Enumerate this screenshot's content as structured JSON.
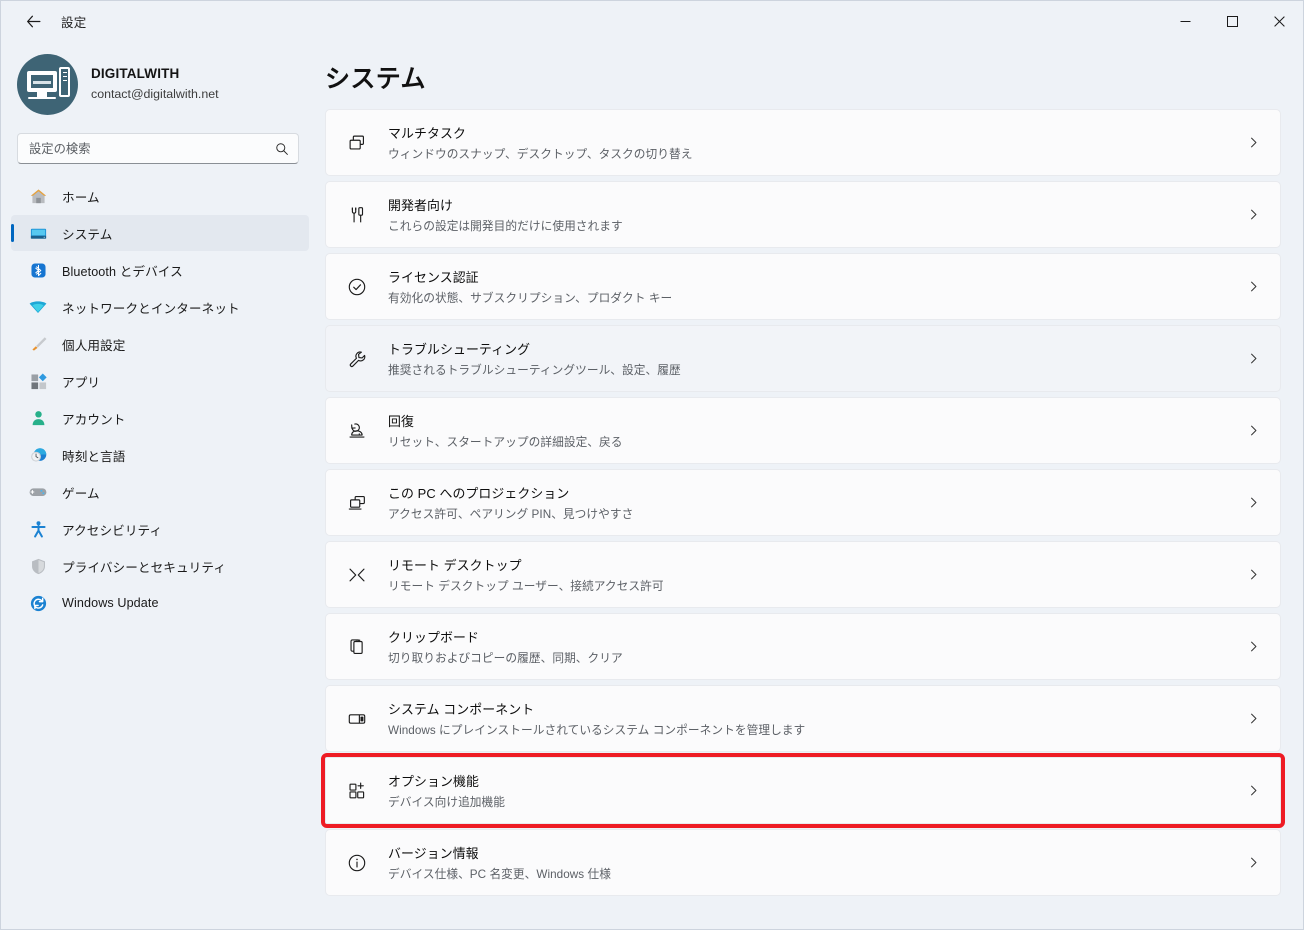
{
  "titlebar": {
    "back_icon": "arrow-left-icon",
    "title": "設定",
    "minimize_label": "–",
    "maximize_label": "□",
    "close_label": "✕"
  },
  "account": {
    "name": "DIGITALWITH",
    "email": "contact@digitalwith.net",
    "avatar_color": "#3e6475"
  },
  "search": {
    "placeholder": "設定の検索",
    "value": "",
    "icon": "search-icon"
  },
  "sidebar": {
    "accent_color": "#0067c0",
    "background": "#eef2f7",
    "items": [
      {
        "label": "ホーム",
        "icon": "home-icon",
        "active": false
      },
      {
        "label": "システム",
        "icon": "monitor-icon",
        "active": true
      },
      {
        "label": "Bluetooth とデバイス",
        "icon": "bluetooth-icon",
        "active": false
      },
      {
        "label": "ネットワークとインターネット",
        "icon": "wifi-icon",
        "active": false
      },
      {
        "label": "個人用設定",
        "icon": "paintbrush-icon",
        "active": false
      },
      {
        "label": "アプリ",
        "icon": "apps-icon",
        "active": false
      },
      {
        "label": "アカウント",
        "icon": "person-icon",
        "active": false
      },
      {
        "label": "時刻と言語",
        "icon": "clock-globe-icon",
        "active": false
      },
      {
        "label": "ゲーム",
        "icon": "gamepad-icon",
        "active": false
      },
      {
        "label": "アクセシビリティ",
        "icon": "accessibility-icon",
        "active": false
      },
      {
        "label": "プライバシーとセキュリティ",
        "icon": "shield-icon",
        "active": false
      },
      {
        "label": "Windows Update",
        "icon": "update-icon",
        "active": false
      }
    ]
  },
  "main": {
    "page_title": "システム",
    "highlight_color": "#ee1b24",
    "cards": [
      {
        "title": "マルチタスク",
        "subtitle": "ウィンドウのスナップ、デスクトップ、タスクの切り替え",
        "icon": "multitask-icon",
        "hovered": false,
        "highlight": false
      },
      {
        "title": "開発者向け",
        "subtitle": "これらの設定は開発目的だけに使用されます",
        "icon": "tools-icon",
        "hovered": false,
        "highlight": false
      },
      {
        "title": "ライセンス認証",
        "subtitle": "有効化の状態、サブスクリプション、プロダクト キー",
        "icon": "check-circle-icon",
        "hovered": false,
        "highlight": false
      },
      {
        "title": "トラブルシューティング",
        "subtitle": "推奨されるトラブルシューティングツール、設定、履歴",
        "icon": "wrench-icon",
        "hovered": true,
        "highlight": false
      },
      {
        "title": "回復",
        "subtitle": "リセット、スタートアップの詳細設定、戻る",
        "icon": "recovery-icon",
        "hovered": false,
        "highlight": false
      },
      {
        "title": "この PC へのプロジェクション",
        "subtitle": "アクセス許可、ペアリング PIN、見つけやすさ",
        "icon": "projection-icon",
        "hovered": false,
        "highlight": false
      },
      {
        "title": "リモート デスクトップ",
        "subtitle": "リモート デスクトップ ユーザー、接続アクセス許可",
        "icon": "remote-desktop-icon",
        "hovered": false,
        "highlight": false
      },
      {
        "title": "クリップボード",
        "subtitle": "切り取りおよびコピーの履歴、同期、クリア",
        "icon": "clipboard-icon",
        "hovered": false,
        "highlight": false
      },
      {
        "title": "システム コンポーネント",
        "subtitle": "Windows にプレインストールされているシステム コンポーネントを管理します",
        "icon": "system-components-icon",
        "hovered": false,
        "highlight": false
      },
      {
        "title": "オプション機能",
        "subtitle": "デバイス向け追加機能",
        "icon": "optional-features-icon",
        "hovered": false,
        "highlight": true
      },
      {
        "title": "バージョン情報",
        "subtitle": "デバイス仕様、PC 名変更、Windows 仕様",
        "icon": "info-circle-icon",
        "hovered": false,
        "highlight": false
      }
    ],
    "chevron_icon": "chevron-right-icon"
  }
}
